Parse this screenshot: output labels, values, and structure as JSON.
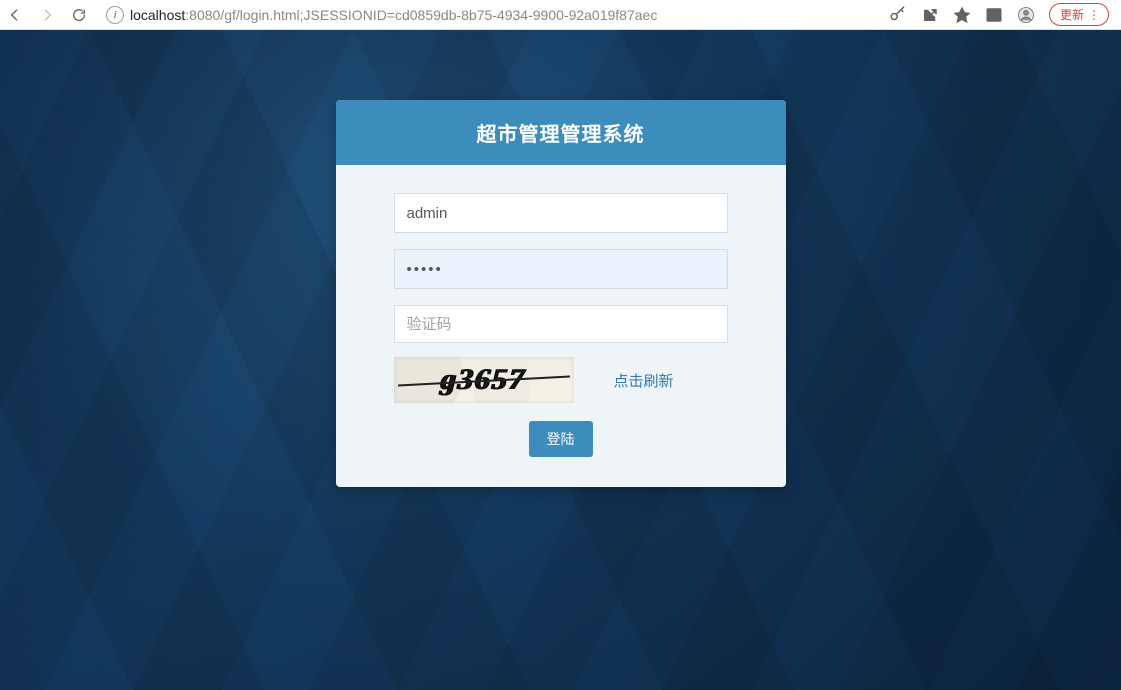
{
  "browser": {
    "url_host": "localhost",
    "url_rest": ":8080/gf/login.html;JSESSIONID=cd0859db-8b75-4934-9900-92a019f87aec",
    "update_label": "更新"
  },
  "login": {
    "title": "超市管理管理系统",
    "username_value": "admin",
    "password_value": "•••••",
    "captcha_placeholder": "验证码",
    "captcha_text": "g3657",
    "refresh_label": "点击刷新",
    "submit_label": "登陆"
  }
}
